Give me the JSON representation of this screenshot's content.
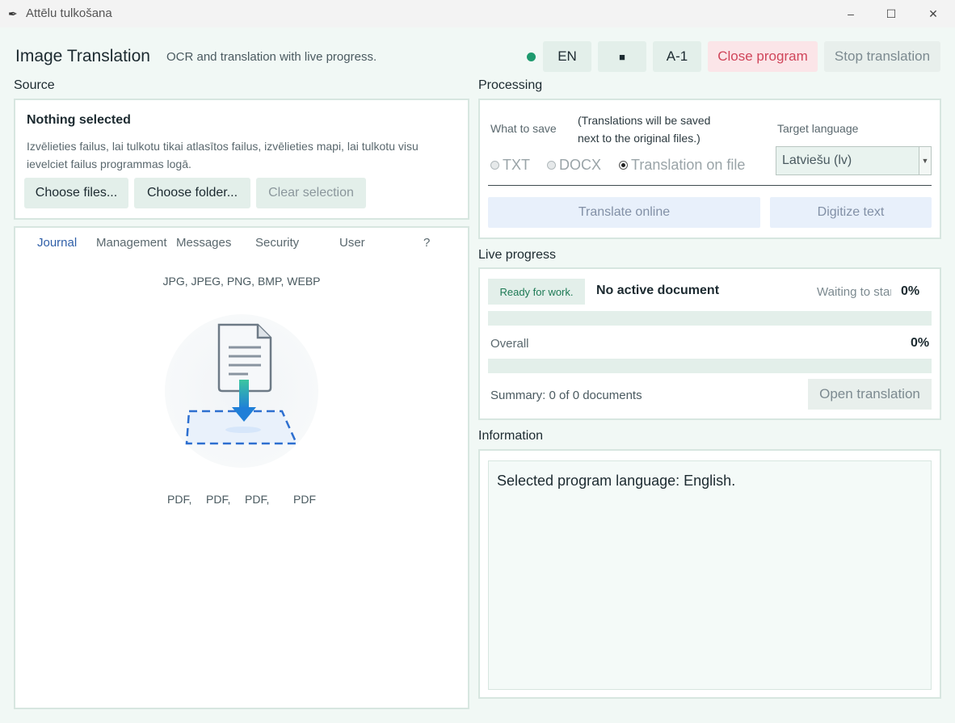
{
  "window": {
    "title": "Attēlu tulkošana"
  },
  "header": {
    "title": "Image Translation",
    "subtitle": "OCR and translation with live progress.",
    "lang_button": "EN",
    "save_icon": "■",
    "font_button": "A-1",
    "close_program": "Close program",
    "stop_translation": "Stop translation",
    "status_color": "#1e9a6e"
  },
  "source": {
    "section_label": "Source",
    "heading": "Nothing selected",
    "description_line1": "Izvēlieties failus, lai tulkotu tikai atlasītos failus, izvēlieties mapi, lai tulkotu visu",
    "description_line2": "ievelciet failus programmas logā.",
    "choose_files": "Choose files...",
    "choose_folder": "Choose folder...",
    "clear_selection": "Clear selection",
    "tabs": [
      "Journal",
      "Management",
      "Messages",
      "Security",
      "User",
      "?"
    ],
    "formats": "JPG, JPEG, PNG, BMP, WEBP",
    "pdf_labels": [
      "PDF,",
      "PDF,",
      "PDF,",
      "PDF"
    ]
  },
  "processing": {
    "section_label": "Processing",
    "what_to_save": "What to save",
    "note_line1": "(Translations will be saved",
    "note_line2": "next to the original files.)",
    "target_language_label": "Target language",
    "options": [
      "TXT",
      "DOCX",
      "Translation on file"
    ],
    "selected_option": "Translation on file",
    "target_language": "Latviešu (lv)",
    "translate_online": "Translate online",
    "digitize_text": "Digitize text"
  },
  "progress": {
    "section_label": "Live progress",
    "badge": "Ready for work.",
    "document": "No active document",
    "waiting": "Waiting to start",
    "document_percent": "0%",
    "document_progress": 0,
    "overall_label": "Overall",
    "overall_percent": "0%",
    "overall_progress": 0,
    "summary": "Summary: 0 of 0 documents",
    "open_translation": "Open translation"
  },
  "information": {
    "section_label": "Information",
    "text": "Selected program language: English."
  }
}
